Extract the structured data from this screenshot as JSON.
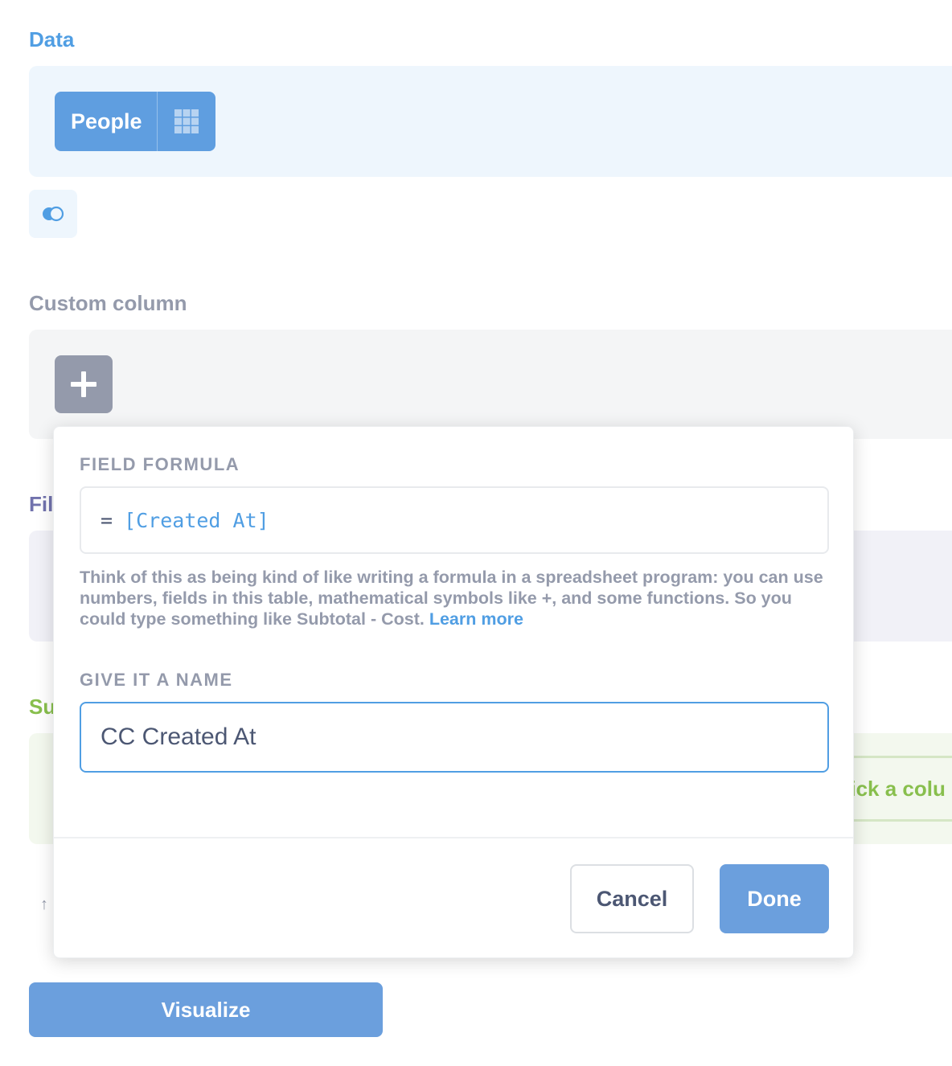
{
  "sections": {
    "data": {
      "title": "Data",
      "table_name": "People"
    },
    "custom_column": {
      "title": "Custom column"
    },
    "filter": {
      "title": "Fil"
    },
    "summarize": {
      "title": "Su",
      "pick_column_text": "Pick a colu"
    }
  },
  "popover": {
    "formula_label": "FIELD FORMULA",
    "formula_prefix": "=",
    "formula_expression": "[Created At]",
    "help_text": "Think of this as being kind of like writing a formula in a spreadsheet program: you can use numbers, fields in this table, mathematical symbols like +, and some functions. So you could type something like Subtotal - Cost.",
    "learn_more": "Learn more",
    "name_label": "GIVE IT A NAME",
    "name_value": "CC Created At",
    "cancel_label": "Cancel",
    "done_label": "Done"
  },
  "visualize_label": "Visualize",
  "icons": [
    "table-grid-icon",
    "join-icon",
    "plus-icon",
    "arrow-up-icon"
  ],
  "colors": {
    "brand": "#509ee3",
    "button_blue": "#6b9fdd",
    "custom_gray": "#949aab",
    "filter_purple": "#7172ad",
    "summarize_green": "#88bf4d"
  }
}
